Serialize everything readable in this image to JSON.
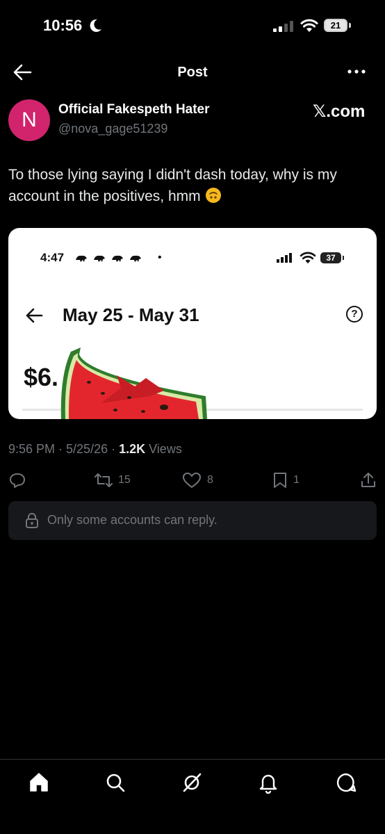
{
  "status_bar": {
    "time": "10:56",
    "battery": "21"
  },
  "header": {
    "title": "Post"
  },
  "author": {
    "avatar_letter": "N",
    "avatar_color": "#d1246d",
    "name": "Official Fakespeth Hater",
    "handle": "@nova_gage51239"
  },
  "watermark": "𝕏.com",
  "post": {
    "text": "To those lying saying I didn't dash today, why is my account in the positives, hmm",
    "emoji": "upside-down-face-emoji",
    "time": "9:56 PM · 5/25/26 · ",
    "views_count": "1.2K",
    "views_label": " Views"
  },
  "embedded_screenshot": {
    "time": "4:47",
    "dot": "•",
    "battery": "37",
    "title": "May 25 - May 31",
    "help": "?",
    "amount": "$6."
  },
  "actions": {
    "retweets": "15",
    "likes": "8",
    "bookmarks": "1"
  },
  "reply_restriction": "Only some accounts can reply.",
  "nav": [
    "home-icon",
    "search-icon",
    "grok-icon",
    "notifications-icon",
    "messages-icon"
  ]
}
